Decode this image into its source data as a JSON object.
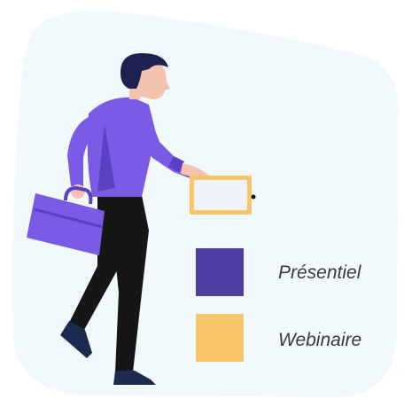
{
  "legend": {
    "items": [
      {
        "label": "Présentiel",
        "color": "#4f3da1"
      },
      {
        "label": "Webinaire",
        "color": "#f7c56a"
      }
    ]
  },
  "colors": {
    "background_blob": "#f2f9fc",
    "shirt": "#7b5be6",
    "shirt_shadow": "#5b41c2",
    "trousers": "#161616",
    "skin": "#f4c3b0",
    "hair": "#1e2050",
    "briefcase": "#7b5be6",
    "tablet_frame": "#f7c56a",
    "tablet_screen": "#eef3fb",
    "shoes": "#1c2a4f"
  }
}
